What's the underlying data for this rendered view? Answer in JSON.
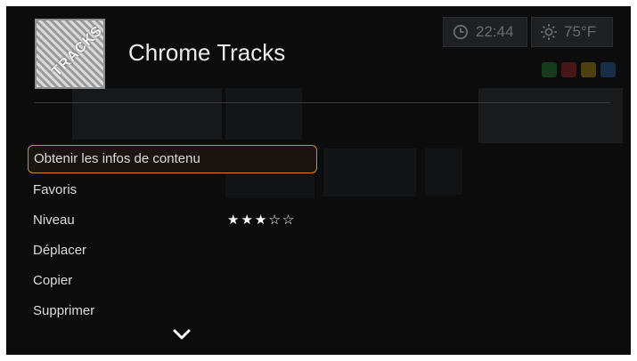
{
  "header": {
    "album_art_text": "TRACKS",
    "title": "Chrome Tracks"
  },
  "status": {
    "time": "22:44",
    "temperature": "75°F",
    "clock_icon": "clock-icon",
    "weather_icon": "sun-icon"
  },
  "menu": {
    "items": [
      {
        "label": "Obtenir les infos de contenu",
        "selected": true
      },
      {
        "label": "Favoris"
      },
      {
        "label": "Niveau",
        "rating": 3,
        "rating_max": 5
      },
      {
        "label": "Déplacer"
      },
      {
        "label": "Copier"
      },
      {
        "label": "Supprimer"
      }
    ],
    "more_icon": "chevron-down-icon"
  },
  "colors": {
    "background": "#0c0c0d",
    "selection_border": "#d88a2a",
    "text": "#dcdcdc",
    "bg_dots": [
      "#2a9a3a",
      "#c2302a",
      "#d8b020",
      "#2a7ac0"
    ]
  }
}
